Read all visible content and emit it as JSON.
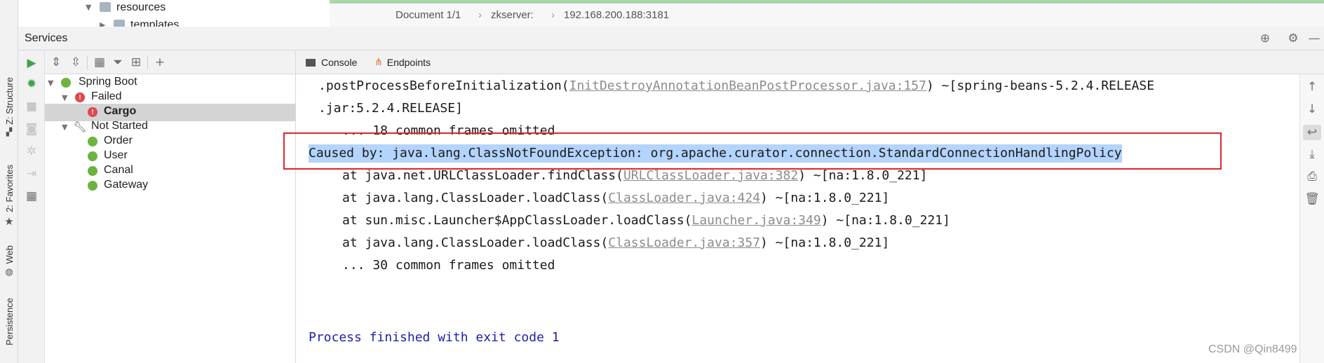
{
  "left_stripe": {
    "tabs": [
      {
        "label": "Z: Structure"
      },
      {
        "label": "2: Favorites"
      },
      {
        "label": "Web"
      },
      {
        "label": "Persistence"
      }
    ]
  },
  "project_tree_peek": {
    "items": [
      {
        "label": "resources"
      },
      {
        "label": "templates"
      }
    ]
  },
  "editor_breadcrumb": {
    "document": "Document 1/1",
    "separator": "›",
    "server": "zkserver:",
    "address": "192.168.200.188:3181"
  },
  "services": {
    "title": "Services",
    "header_icons": [
      "target-icon",
      "gear-icon",
      "minimize-icon"
    ]
  },
  "tree": {
    "root": {
      "label": "Spring Boot"
    },
    "failed_group": {
      "label": "Failed"
    },
    "failed_items": [
      {
        "label": "Cargo"
      }
    ],
    "not_started_group": {
      "label": "Not Started"
    },
    "not_started_items": [
      {
        "label": "Order"
      },
      {
        "label": "User"
      },
      {
        "label": "Canal"
      },
      {
        "label": "Gateway"
      }
    ]
  },
  "tabs": {
    "console": "Console",
    "endpoints": "Endpoints"
  },
  "console": {
    "line1_pre": ".postProcessBeforeInitialization(",
    "line1_link": "InitDestroyAnnotationBeanPostProcessor.java:157",
    "line1_post": ") ~[spring-beans-5.2.4.RELEASE",
    "line2": ".jar:5.2.4.RELEASE]",
    "line3": "... 18 common frames omitted",
    "caused_by": "Caused by: java.lang.ClassNotFoundException: org.apache.curator.connection.StandardConnectionHandlingPolicy",
    "frames": [
      {
        "pre": "at java.net.URLClassLoader.findClass(",
        "link": "URLClassLoader.java:382",
        "post": ") ~[na:1.8.0_221]"
      },
      {
        "pre": "at java.lang.ClassLoader.loadClass(",
        "link": "ClassLoader.java:424",
        "post": ") ~[na:1.8.0_221]"
      },
      {
        "pre": "at sun.misc.Launcher$AppClassLoader.loadClass(",
        "link": "Launcher.java:349",
        "post": ") ~[na:1.8.0_221]"
      },
      {
        "pre": "at java.lang.ClassLoader.loadClass(",
        "link": "ClassLoader.java:357",
        "post": ") ~[na:1.8.0_221]"
      }
    ],
    "omitted2": "... 30 common frames omitted",
    "exit_message": "Process finished with exit code 1"
  },
  "watermark": "CSDN @Qin8499",
  "colors": {
    "highlight_box": "#e0242e",
    "selection": "#b3d4fc",
    "exit_text": "#1f1fa8",
    "link": "#8c8c8c",
    "run_green": "#3fa34d",
    "error_red": "#e0464e",
    "tab_underline": "#4a88c7"
  }
}
